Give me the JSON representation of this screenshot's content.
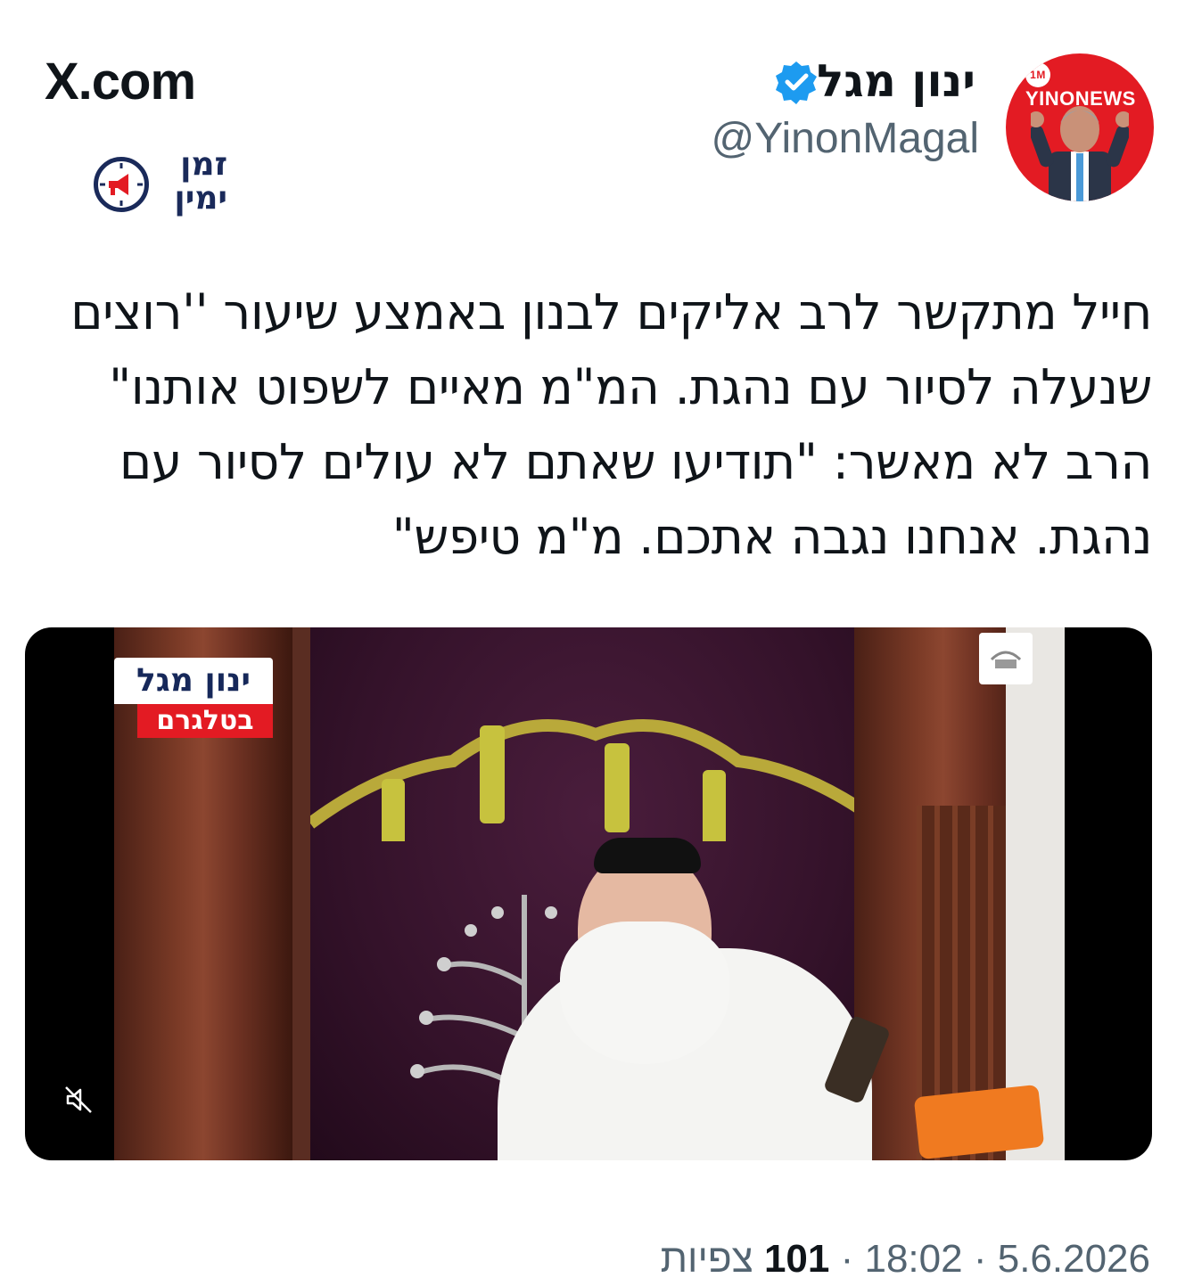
{
  "site": {
    "brand": "X.com"
  },
  "logo": {
    "line1": "זמן",
    "line2": "ימין"
  },
  "author": {
    "name": "ינון מגל",
    "handle": "@YinonMagal",
    "avatar_badge": "YINONEWS",
    "avatar_badge_prefix": "1M",
    "verified": true
  },
  "tweet": {
    "text": "חייל מתקשר לרב אליקים לבנון באמצע שיעור ''רוצים שנעלה לסיור עם נהגת. המ\"מ מאיים לשפוט אותנו\" הרב לא מאשר: \"תודיעו שאתם לא עולים לסיור עם נהגת. אנחנו נגבה אתכם. מ\"מ טיפש\""
  },
  "video": {
    "channel_tag_top": "ינון מגל",
    "channel_tag_bottom": "בטלגרם",
    "muted": true
  },
  "meta": {
    "date": "5.6.2026",
    "time": "18:02",
    "separator": "·",
    "views_count": "101",
    "views_label": "צפיות"
  },
  "colors": {
    "verified_blue": "#1d9bf0",
    "avatar_red": "#e31b23",
    "text_primary": "#0f1419",
    "text_secondary": "#536471",
    "logo_navy": "#1a2a5a"
  }
}
